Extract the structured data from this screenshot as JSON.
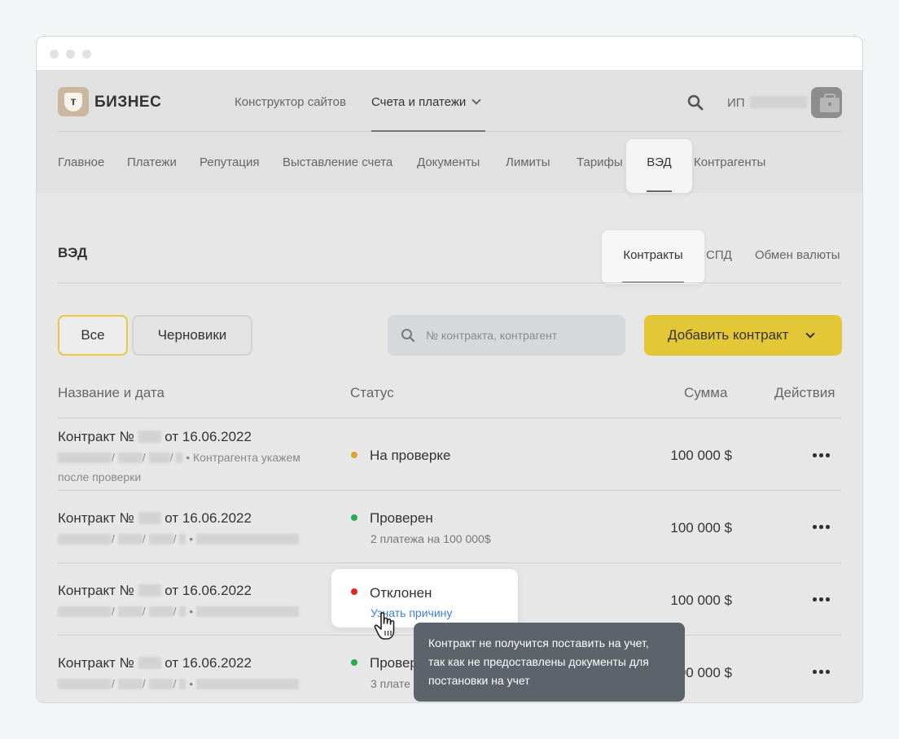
{
  "brand": {
    "logo_letter": "т",
    "name": "БИЗНЕС"
  },
  "top_nav": {
    "items": [
      "Конструктор сайтов",
      "Счета и платежи"
    ]
  },
  "user": {
    "prefix": "ИП"
  },
  "sub_nav": {
    "items": [
      "Главное",
      "Платежи",
      "Репутация",
      "Выставление счета",
      "Документы",
      "Лимиты",
      "Тарифы",
      "ВЭД",
      "Контрагенты"
    ],
    "active": "ВЭД"
  },
  "page": {
    "title": "ВЭД",
    "tabs": [
      "Контракты",
      "СПД",
      "Обмен валюты"
    ],
    "active_tab": "Контракты"
  },
  "filters": {
    "all": "Все",
    "drafts": "Черновики"
  },
  "search": {
    "placeholder": "№ контракта, контрагент"
  },
  "add_button": {
    "label": "Добавить контракт"
  },
  "table": {
    "headers": {
      "name": "Название и дата",
      "status": "Статус",
      "amount": "Сумма",
      "actions": "Действия"
    },
    "rows": [
      {
        "title_prefix": "Контракт №",
        "title_suffix": "от 16.06.2022",
        "sub_note": "Контрагента укажем",
        "sub_note2": "после проверки",
        "status": "На проверке",
        "status_color": "#e0a32a",
        "amount": "100 000 $"
      },
      {
        "title_prefix": "Контракт №",
        "title_suffix": "от 16.06.2022",
        "status": "Проверен",
        "status_color": "#2cab4a",
        "status_sub": "2 платежа на 100 000$",
        "amount": "100 000 $"
      },
      {
        "title_prefix": "Контракт №",
        "title_suffix": "от 16.06.2022",
        "status": "Отклонен",
        "status_color": "#e02525",
        "status_link": "Узнать причину",
        "amount": "100 000 $"
      },
      {
        "title_prefix": "Контракт №",
        "title_suffix": "от 16.06.2022",
        "status": "Провер",
        "status_color": "#2cab4a",
        "status_sub": "3 плате",
        "amount": "00 000 $"
      }
    ]
  },
  "tooltip": {
    "lines": [
      "Контракт не получится поставить на учет,",
      "так как не предоставлены документы для",
      "постановки на учет"
    ]
  }
}
